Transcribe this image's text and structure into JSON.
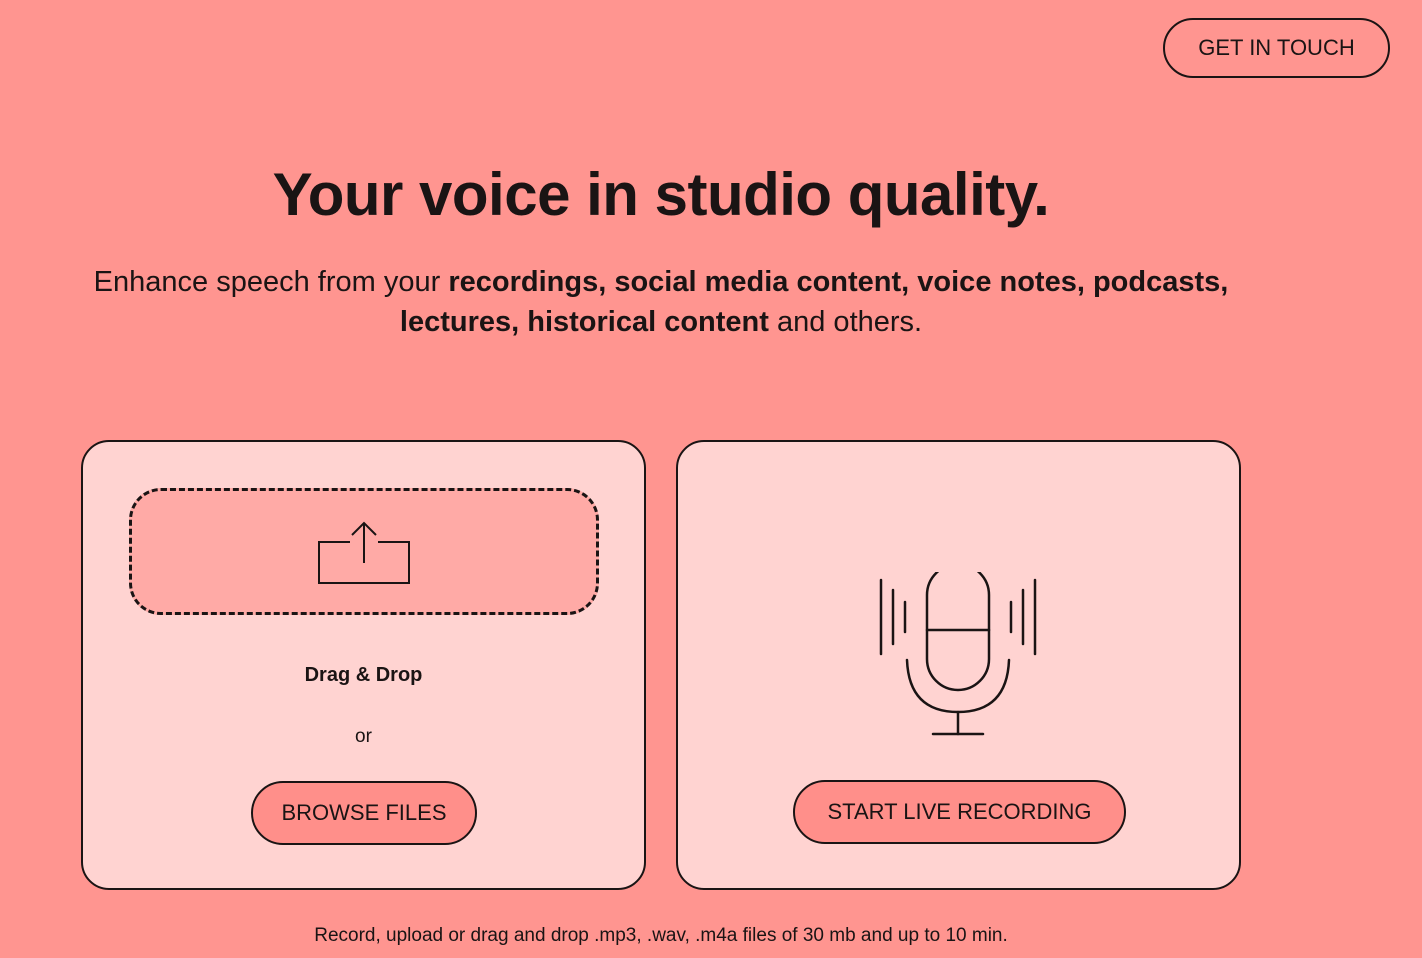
{
  "header": {
    "get_in_touch_label": "GET IN TOUCH"
  },
  "hero": {
    "headline": "Your voice in studio quality.",
    "sub_lead": "Enhance speech from your ",
    "sub_bold_1": "recordings, social media content, voice notes, podcasts, lectures, historical content",
    "sub_tail": " and others."
  },
  "upload_card": {
    "drop_icon": "upload-icon",
    "drag_label": "Drag & Drop",
    "or_label": "or",
    "browse_label": "BROWSE FILES"
  },
  "record_card": {
    "mic_icon": "microphone-icon",
    "live_label": "START LIVE RECORDING"
  },
  "footnote": "Record, upload or drag and drop .mp3, .wav, .m4a files of 30 mb and up to 10 min.",
  "colors": {
    "background": "#ff9590",
    "card": "#ffd3d1",
    "dropzone": "#ffaaa6",
    "button": "#ff8f8a",
    "ink": "#1a1414"
  }
}
